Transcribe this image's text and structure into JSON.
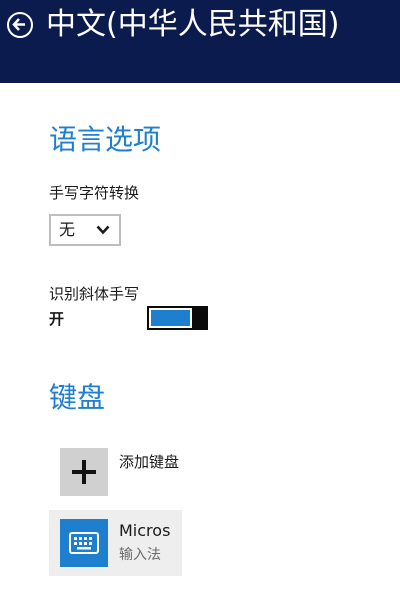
{
  "header": {
    "title": "中文(中华人民共和国)",
    "back_icon": "back-arrow-circle-icon"
  },
  "language_options": {
    "heading": "语言选项",
    "handwriting_conversion": {
      "label": "手写字符转换",
      "selected": "无"
    },
    "italic_handwriting": {
      "label": "识别斜体手写",
      "state_text": "开",
      "is_on": true
    }
  },
  "keyboard": {
    "heading": "键盘",
    "add_label": "添加键盘",
    "add_icon": "plus-icon",
    "items": [
      {
        "name": "Micros",
        "subtitle": "输入法",
        "icon": "keyboard-icon"
      }
    ]
  },
  "colors": {
    "header_bg": "#0c1b4e",
    "accent": "#1f7fcf"
  }
}
